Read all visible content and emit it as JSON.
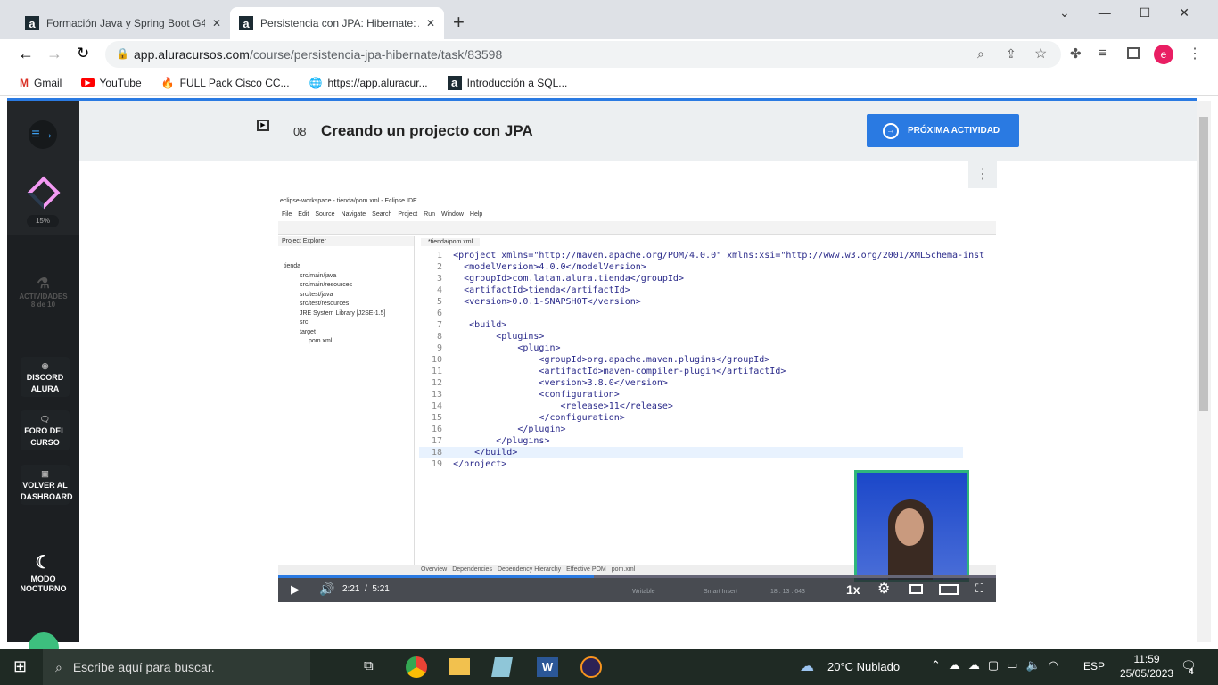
{
  "browser": {
    "tabs": [
      {
        "title": "Formación Java y Spring Boot G4",
        "active": false
      },
      {
        "title": "Persistencia con JPA: Hibernate: A",
        "active": true
      }
    ],
    "new_tab": "+",
    "url_host": "app.aluracursos.com",
    "url_path": "/course/persistencia-jpa-hibernate/task/83598",
    "bookmarks": [
      {
        "label": "Gmail",
        "icon": "gmail-icon"
      },
      {
        "label": "YouTube",
        "icon": "youtube-icon"
      },
      {
        "label": "FULL Pack Cisco CC...",
        "icon": "fire-icon"
      },
      {
        "label": "https://app.aluracur...",
        "icon": "globe-icon"
      },
      {
        "label": "Introducción a SQL...",
        "icon": "alura-icon"
      }
    ],
    "profile_initial": "e"
  },
  "sidebar": {
    "progress": "15%",
    "progress_value": 15,
    "activities_label": "ACTIVIDADES",
    "activities_count": "8 de 10",
    "buttons": [
      {
        "l1": "DISCORD",
        "l2": "ALURA"
      },
      {
        "l1": "FORO DEL",
        "l2": "CURSO"
      },
      {
        "l1": "VOLVER AL",
        "l2": "DASHBOARD"
      }
    ],
    "night_l1": "MODO",
    "night_l2": "NOCTURNO"
  },
  "header": {
    "number": "08",
    "title": "Creando un projecto con JPA",
    "next_button": "PRÓXIMA ACTIVIDAD"
  },
  "video": {
    "eclipse_title": "eclipse-workspace - tienda/pom.xml - Eclipse IDE",
    "menu": [
      "File",
      "Edit",
      "Source",
      "Navigate",
      "Search",
      "Project",
      "Run",
      "Window",
      "Help"
    ],
    "explorer_title": "Project Explorer",
    "tree": [
      "tienda",
      "src/main/java",
      "src/main/resources",
      "src/test/java",
      "src/test/resources",
      "JRE System Library [J2SE-1.5]",
      "src",
      "target",
      "pom.xml"
    ],
    "editor_tab": "*tienda/pom.xml",
    "code": [
      "<project xmlns=\"http://maven.apache.org/POM/4.0.0\" xmlns:xsi=\"http://www.w3.org/2001/XMLSchema-inst",
      "  <modelVersion>4.0.0</modelVersion>",
      "  <groupId>com.latam.alura.tienda</groupId>",
      "  <artifactId>tienda</artifactId>",
      "  <version>0.0.1-SNAPSHOT</version>",
      "",
      "   <build>",
      "        <plugins>",
      "            <plugin>",
      "                <groupId>org.apache.maven.plugins</groupId>",
      "                <artifactId>maven-compiler-plugin</artifactId>",
      "                <version>3.8.0</version>",
      "                <configuration>",
      "                    <release>11</release>",
      "                </configuration>",
      "            </plugin>",
      "        </plugins>",
      "    </build>",
      "</project>"
    ],
    "pom_tabs": [
      "Overview",
      "Dependencies",
      "Dependency Hierarchy",
      "Effective POM",
      "pom.xml"
    ],
    "status": [
      "Writable",
      "Smart Insert",
      "18 : 13 : 643"
    ],
    "current_time": "2:21",
    "duration": "5:21",
    "separator": "/",
    "progress_fraction": 0.44,
    "speed": "1x"
  },
  "taskbar": {
    "search_placeholder": "Escribe aquí para buscar.",
    "weather": "20°C  Nublado",
    "lang": "ESP",
    "time": "11:59",
    "date": "25/05/2023",
    "notifications": "4"
  }
}
